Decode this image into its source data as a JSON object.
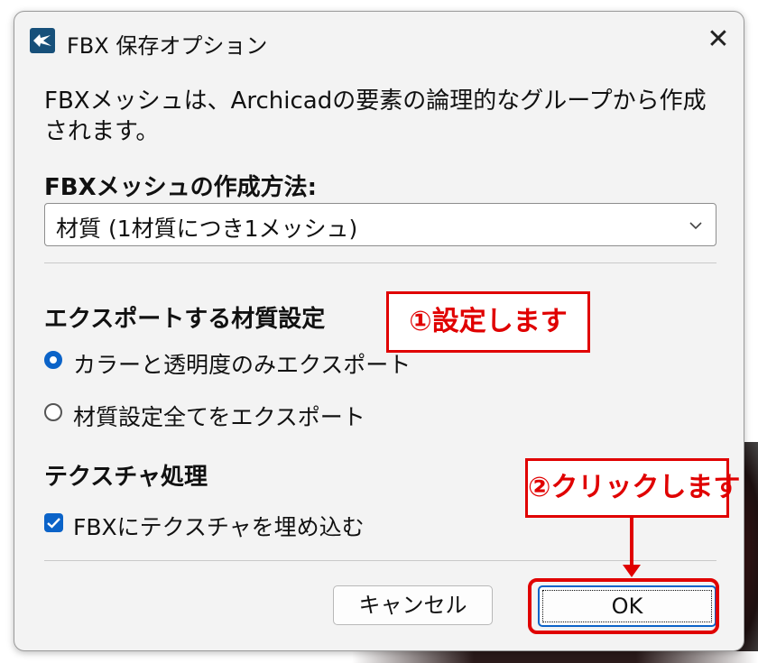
{
  "window": {
    "title": "FBX 保存オプション",
    "close_glyph": "✕"
  },
  "description": "FBXメッシュは、Archicadの要素の論理的なグループから作成されます。",
  "mesh_method": {
    "heading": "FBXメッシュの作成方法:",
    "selected": "材質 (1材質につき1メッシュ)"
  },
  "material_export": {
    "heading": "エクスポートする材質設定",
    "options": [
      {
        "label": "カラーと透明度のみエクスポート",
        "selected": true
      },
      {
        "label": "材質設定全てをエクスポート",
        "selected": false
      }
    ]
  },
  "texture": {
    "heading": "テクスチャ処理",
    "embed_label": "FBXにテクスチャを埋め込む",
    "embed_checked": true
  },
  "buttons": {
    "cancel": "キャンセル",
    "ok": "OK"
  },
  "annotations": {
    "callout1": "①設定します",
    "callout2": "②クリックします"
  },
  "colors": {
    "accent": "#0b63c8",
    "annotation_red": "#e00000",
    "app_icon": "#17507a"
  },
  "icons": {
    "app": "archicad-app-icon",
    "close": "close-icon",
    "dropdown": "chevron-down-icon",
    "check": "checkmark-icon"
  }
}
